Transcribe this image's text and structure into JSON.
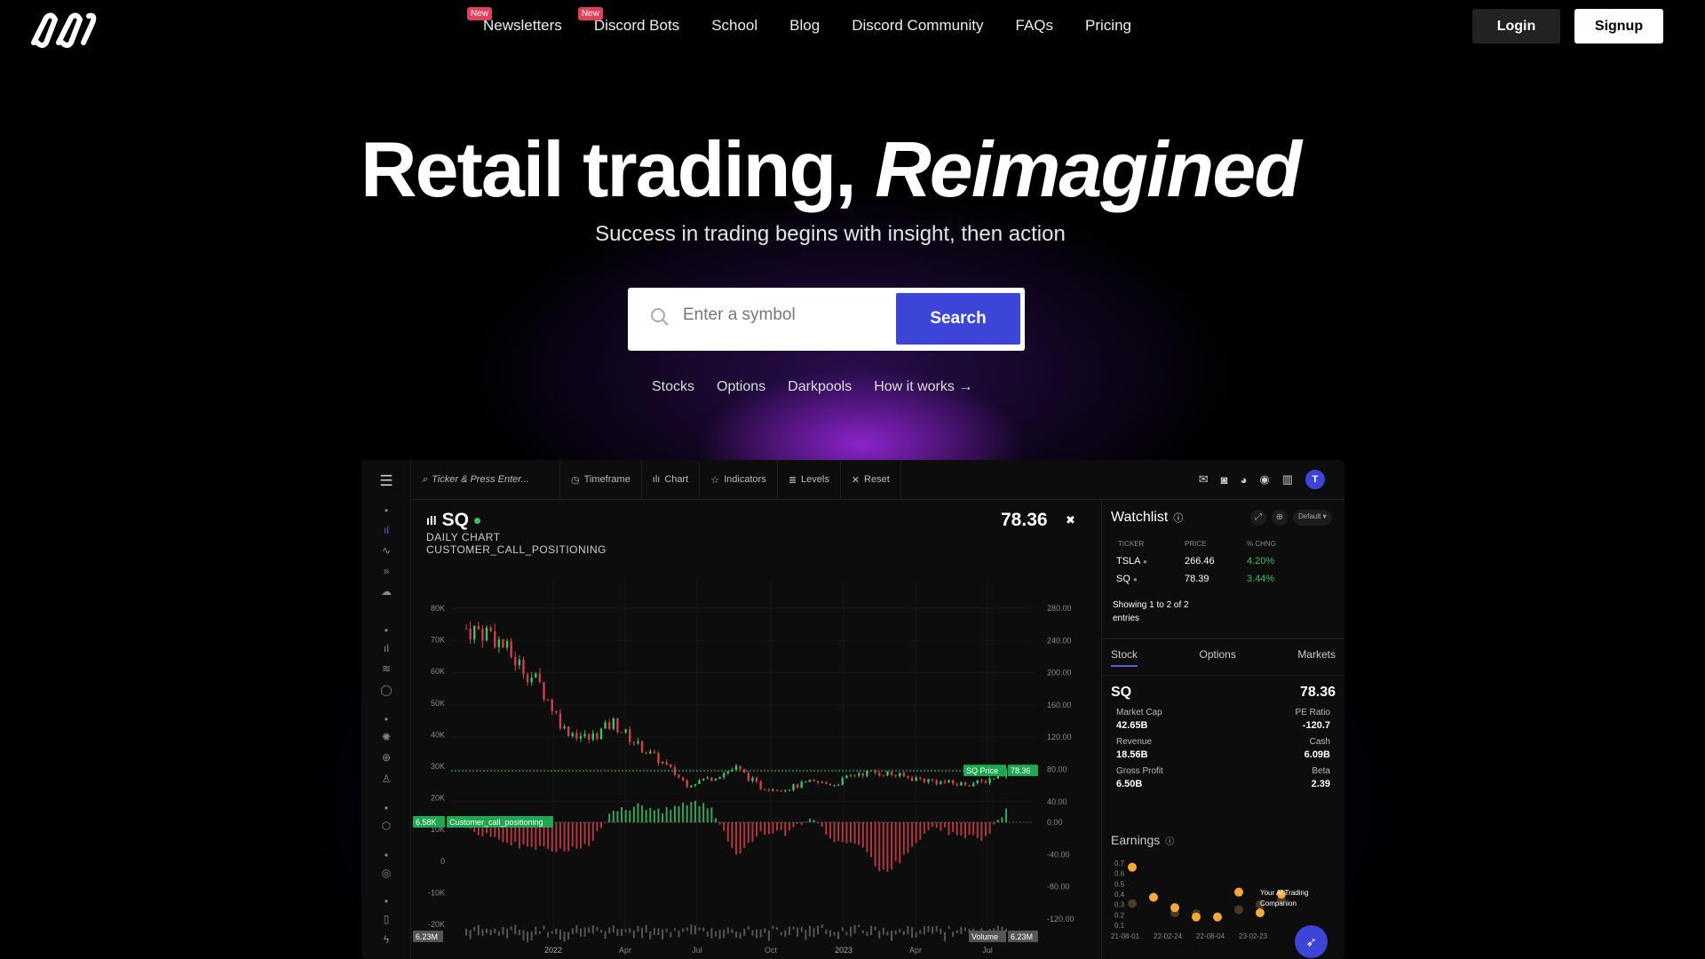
{
  "nav": {
    "links": [
      {
        "label": "Newsletters",
        "badge": "New"
      },
      {
        "label": "Discord Bots",
        "badge": "New"
      },
      {
        "label": "School"
      },
      {
        "label": "Blog"
      },
      {
        "label": "Discord Community"
      },
      {
        "label": "FAQs"
      },
      {
        "label": "Pricing"
      }
    ],
    "login": "Login",
    "signup": "Signup"
  },
  "hero": {
    "title": "Retail trading, ",
    "title_em": "Reimagined",
    "subtitle": "Success in trading begins with insight, then action",
    "search_placeholder": "Enter a symbol",
    "search_button": "Search",
    "links": [
      "Stocks",
      "Options",
      "Darkpools",
      "How it works →"
    ]
  },
  "app": {
    "toolbar": {
      "ticker_placeholder": "Ticker & Press Enter...",
      "items": [
        "Timeframe",
        "Chart",
        "Indicators",
        "Levels",
        "Reset"
      ]
    },
    "chart": {
      "symbol": "SQ",
      "line1": "DAILY CHART",
      "line2": "CUSTOMER_CALL_POSITIONING",
      "price": "78.36",
      "price_tag_label": "SQ Price",
      "price_tag": "78.36",
      "osc_tag_value": "6.58K",
      "osc_tag_label": "Customer_call_positioning",
      "volume_left": "6.23M",
      "volume_label": "Volume",
      "volume_right": "6.23M",
      "left_ticks": [
        "80K",
        "70K",
        "60K",
        "50K",
        "40K",
        "30K",
        "20K",
        "10K",
        "0",
        "-10K",
        "-20K"
      ],
      "price_ticks": [
        "280.00",
        "240.00",
        "200.00",
        "160.00",
        "120.00",
        "80.00",
        "40.00"
      ],
      "osc_ticks": [
        "0.00",
        "-40.00",
        "-80.00",
        "-120.00"
      ],
      "x_ticks": [
        "2022",
        "Apr",
        "Jul",
        "Oct",
        "2023",
        "Apr",
        "Jul"
      ]
    },
    "chart_data": {
      "type": "candlestick",
      "months": [
        "2021-09",
        "2021-10",
        "2021-11",
        "2021-12",
        "2022-01",
        "2022-02",
        "2022-03",
        "2022-04",
        "2022-05",
        "2022-06",
        "2022-07",
        "2022-08",
        "2022-09",
        "2022-10",
        "2022-11",
        "2022-12",
        "2023-01",
        "2023-02",
        "2023-03",
        "2023-04",
        "2023-05",
        "2023-06",
        "2023-07"
      ],
      "price_close": [
        255,
        250,
        215,
        185,
        130,
        118,
        138,
        110,
        88,
        62,
        70,
        82,
        58,
        56,
        64,
        62,
        76,
        76,
        70,
        66,
        62,
        64,
        78
      ],
      "customer_call_positioning": [
        -5,
        -20,
        -28,
        -32,
        -35,
        -30,
        15,
        20,
        14,
        25,
        18,
        -42,
        -12,
        -14,
        6,
        -22,
        -30,
        -62,
        -40,
        -4,
        -16,
        -22,
        14
      ],
      "price_range": [
        40,
        280
      ],
      "osc_range": [
        -120,
        10
      ],
      "colors": {
        "up": "#3fbf6a",
        "down": "#d0404a"
      }
    },
    "watchlist": {
      "title": "Watchlist",
      "dropdown": "Default",
      "headers": [
        "TICKER",
        "PRICE",
        "% CHNG"
      ],
      "rows": [
        {
          "ticker": "TSLA",
          "price": "266.46",
          "change": "4.20%"
        },
        {
          "ticker": "SQ",
          "price": "78.39",
          "change": "3.44%"
        }
      ],
      "footer": "Showing 1 to 2 of 2 entries"
    },
    "tabs": [
      "Stock",
      "Options",
      "Markets"
    ],
    "stock": {
      "symbol": "SQ",
      "price": "78.36",
      "stats": [
        {
          "label": "Market Cap",
          "value": "42.65B"
        },
        {
          "label": "PE Ratio",
          "value": "-120.7"
        },
        {
          "label": "Revenue",
          "value": "18.56B"
        },
        {
          "label": "Cash",
          "value": "6.09B"
        },
        {
          "label": "Gross Profit",
          "value": "6.50B"
        },
        {
          "label": "Beta",
          "value": "2.39"
        }
      ]
    },
    "earnings": {
      "title": "Earnings",
      "y_ticks": [
        "0.7",
        "0.6",
        "0.5",
        "0.4",
        "0.3",
        "0.2",
        "0.1"
      ],
      "x_ticks": [
        "21-08-01",
        "22-02-24",
        "22-08-04",
        "23-02-23"
      ],
      "actual": [
        0.66,
        0.37,
        0.27,
        0.18,
        0.18,
        0.42,
        0.22,
        0.4
      ],
      "estimate": [
        0.31,
        0.37,
        0.22,
        0.21,
        0.18,
        0.25,
        0.3,
        0.35
      ]
    },
    "assistant": {
      "label": "Your AI Trading Companion"
    }
  }
}
